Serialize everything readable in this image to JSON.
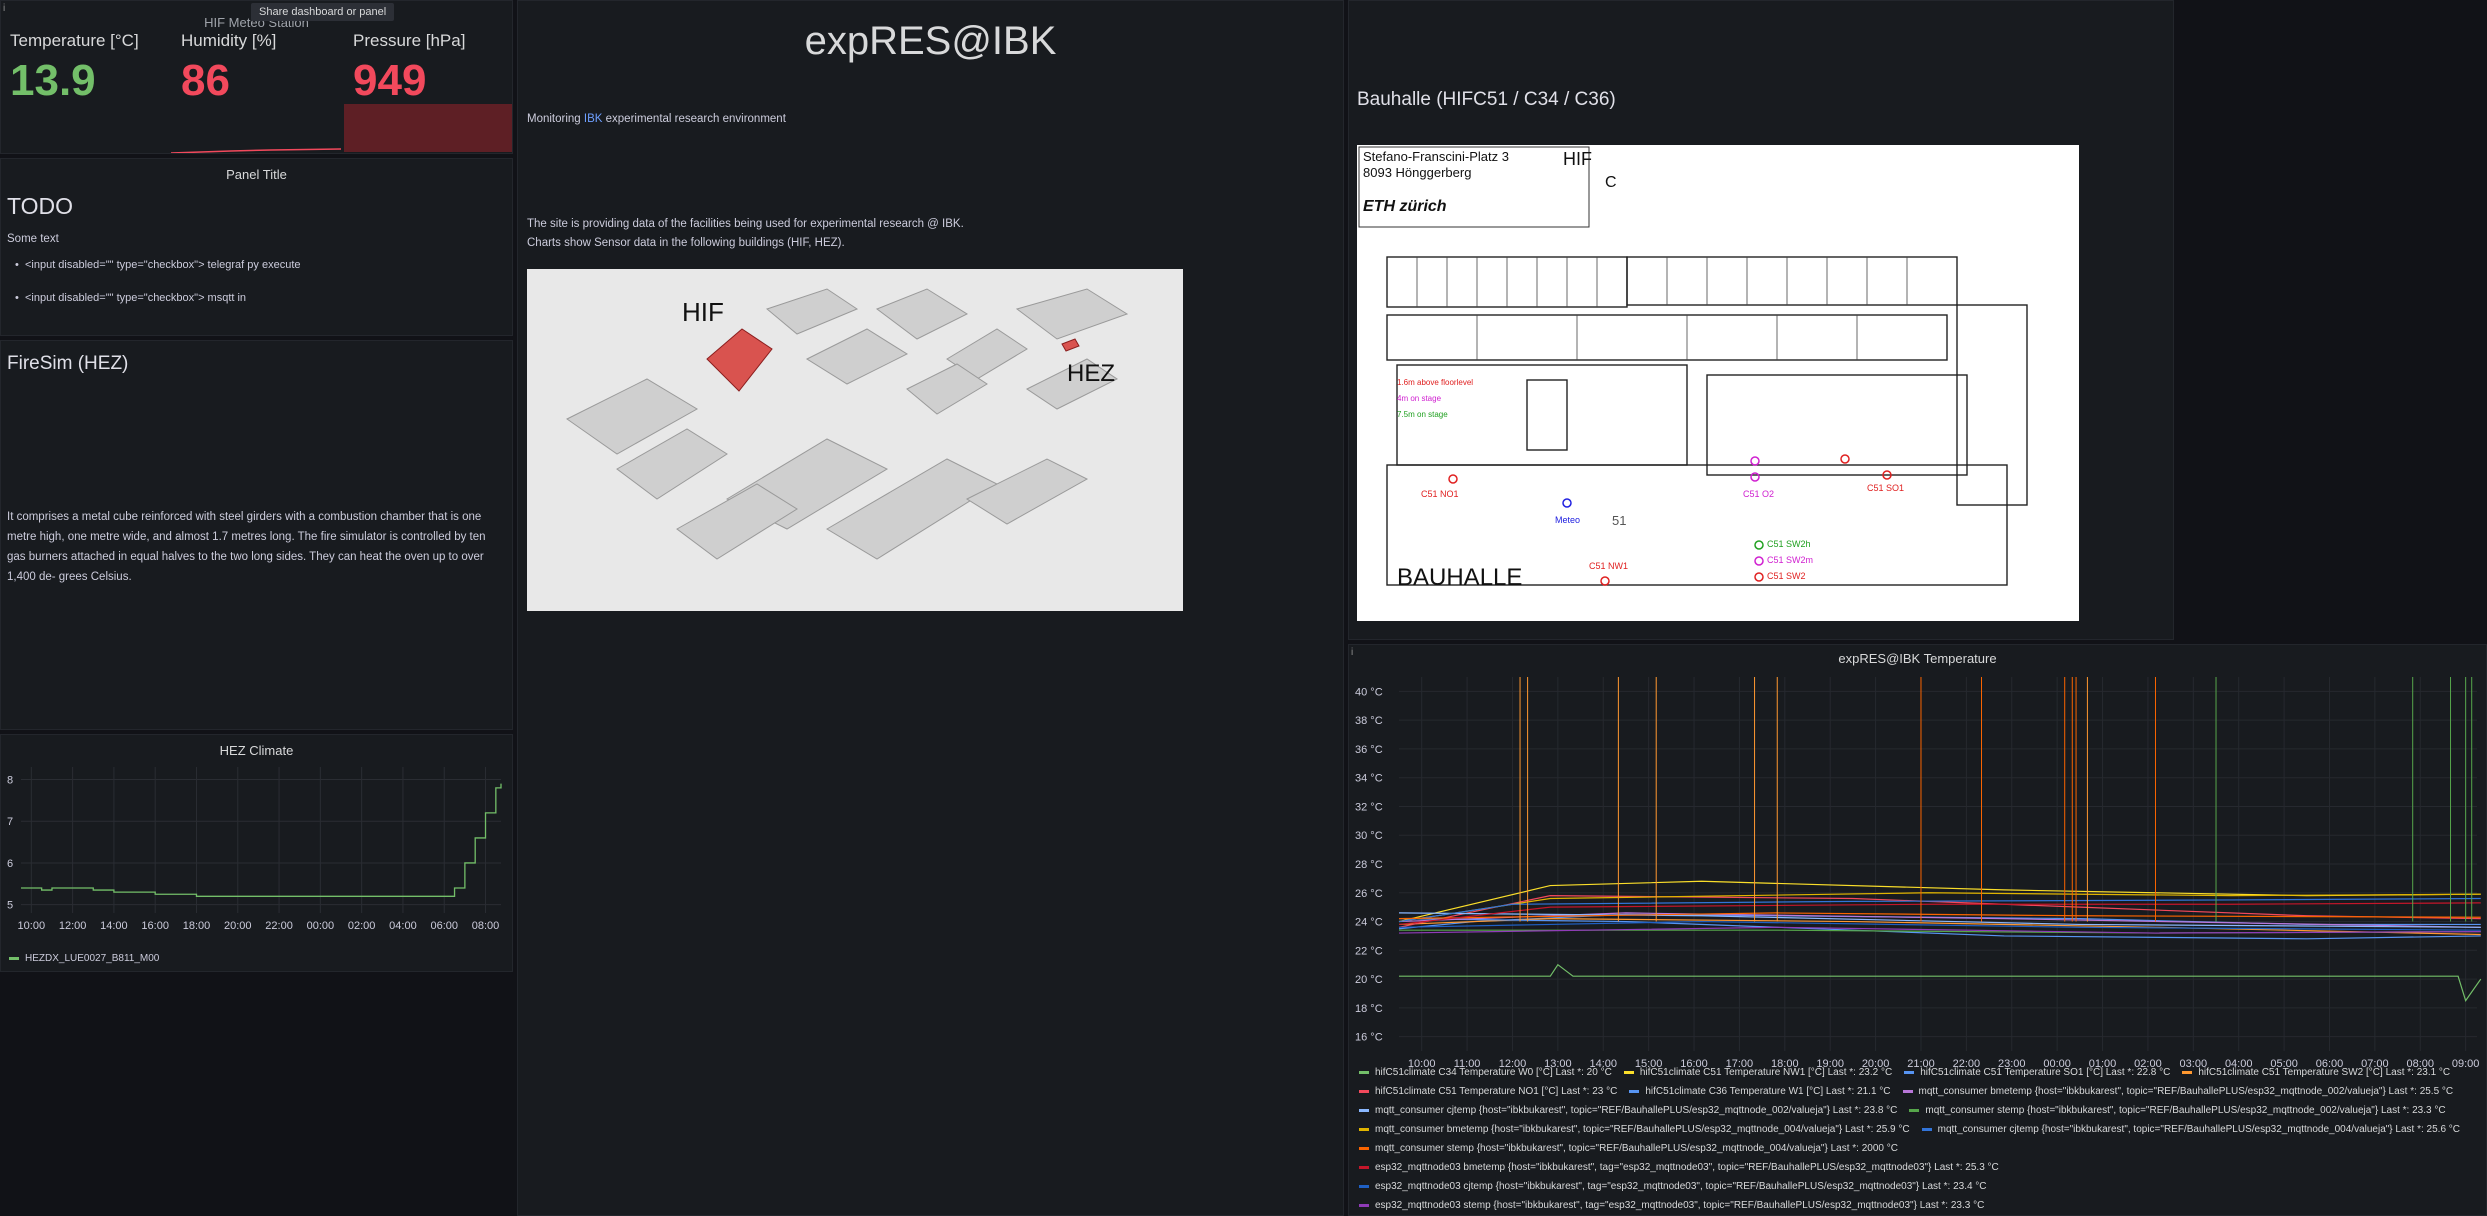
{
  "meteo": {
    "title": "HIF Meteo Station",
    "tooltip": "Share dashboard or panel",
    "corner": "i",
    "stats": [
      {
        "label": "Temperature [°C]",
        "value": "13.9",
        "color": "#73bf69"
      },
      {
        "label": "Humidity [%]",
        "value": "86",
        "color": "#f2495c"
      },
      {
        "label": "Pressure [hPa]",
        "value": "949",
        "color": "#f2495c"
      }
    ]
  },
  "todo": {
    "title": "Panel Title",
    "heading": "TODO",
    "text": "Some text",
    "items": [
      "<input disabled=\"\" type=\"checkbox\"> telegraf py execute",
      "<input disabled=\"\" type=\"checkbox\"> msqtt in"
    ]
  },
  "firesim": {
    "heading": "FireSim (HEZ)",
    "text": "It comprises a metal cube reinforced with steel girders with a combustion chamber that is one metre high, one metre wide, and almost 1.7 metres long. The fire simulator is controlled by ten gas burners attached in equal halves to the two long sides. They can heat the oven up to over 1,400 de- grees Celsius."
  },
  "hez": {
    "title": "HEZ Climate",
    "legend": "HEZDX_LUE0027_B811_M00",
    "series_color": "#73bf69",
    "chart_data": {
      "type": "line",
      "x": [
        "09:30",
        "10:00",
        "10:30",
        "11:00",
        "12:00",
        "13:00",
        "14:00",
        "15:00",
        "16:00",
        "18:00",
        "20:00",
        "22:00",
        "00:00",
        "02:00",
        "04:00",
        "06:00",
        "06:30",
        "07:00",
        "07:30",
        "08:00",
        "08:30",
        "08:45"
      ],
      "values": [
        5.4,
        5.4,
        5.35,
        5.4,
        5.4,
        5.35,
        5.3,
        5.3,
        5.25,
        5.2,
        5.2,
        5.2,
        5.2,
        5.2,
        5.2,
        5.2,
        5.4,
        6.0,
        6.6,
        7.2,
        7.8,
        7.9
      ],
      "xticks": [
        "10:00",
        "12:00",
        "14:00",
        "16:00",
        "18:00",
        "20:00",
        "22:00",
        "00:00",
        "02:00",
        "04:00",
        "06:00",
        "08:00"
      ],
      "yticks": [
        "5",
        "6",
        "7",
        "8"
      ],
      "ylim": [
        4.8,
        8.3
      ]
    }
  },
  "expres": {
    "title": "expRES@IBK",
    "line1_pre": "Monitoring ",
    "line1_link": "IBK",
    "line1_post": " experimental research environment",
    "line2": "The site is providing data of the facilities being used for experimental research @ IBK.",
    "line3": "Charts show Sensor data in the following buildings (HIF, HEZ).",
    "map_hif": "HIF",
    "map_hez": "HEZ"
  },
  "bauhalle": {
    "title": "Bauhalle (HIFC51 / C34 / C36)",
    "addr1": "Stefano-Franscini-Platz 3",
    "addr2": "8093 Hönggerberg",
    "logo": "ETH zürich",
    "bldg": "HIF",
    "bldg_letter": "C",
    "hall": "BAUHALLE",
    "room": "51",
    "legend": [
      "1.6m above floorlevel",
      "4m on stage",
      "7.5m on stage"
    ],
    "sensors": [
      "C51 NO1",
      "C51 NW1",
      "Meteo",
      "C51 SW2h",
      "C51 SW2m",
      "C51 SW2",
      "C51 SO1",
      "C51 O2"
    ]
  },
  "temp": {
    "title": "expRES@IBK Temperature",
    "corner": "i",
    "yticks": [
      "16 °C",
      "18 °C",
      "20 °C",
      "22 °C",
      "24 °C",
      "26 °C",
      "28 °C",
      "30 °C",
      "32 °C",
      "34 °C",
      "36 °C",
      "38 °C",
      "40 °C"
    ],
    "xticks": [
      "10:00",
      "11:00",
      "12:00",
      "13:00",
      "14:00",
      "15:00",
      "16:00",
      "17:00",
      "18:00",
      "19:00",
      "20:00",
      "21:00",
      "22:00",
      "23:00",
      "00:00",
      "01:00",
      "02:00",
      "03:00",
      "04:00",
      "05:00",
      "06:00",
      "07:00",
      "08:00",
      "09:00"
    ],
    "chart_data": {
      "type": "line",
      "ylim": [
        15,
        41
      ],
      "series": [
        {
          "name": "hifC51climate C34 Temperature W0 [°C]",
          "color": "#73bf69",
          "last": "20 °C"
        },
        {
          "name": "hifC51climate C51 Temperature NW1 [°C]",
          "color": "#fade2a",
          "last": "23.2 °C"
        },
        {
          "name": "hifC51climate C51 Temperature SO1 [°C]",
          "color": "#5794f2",
          "last": "22.8 °C"
        },
        {
          "name": "hifC51climate C51 Temperature SW2 [°C]",
          "color": "#ff9830",
          "last": "23.1 °C"
        },
        {
          "name": "hifC51climate C51 Temperature NO1 [°C]",
          "color": "#f2495c",
          "last": "23 °C"
        },
        {
          "name": "hifC51climate C36 Temperature W1 [°C]",
          "color": "#5794f2",
          "last": "21.1 °C"
        },
        {
          "name": "mqtt_consumer bmetemp {host=\"ibkbukarest\", topic=\"REF/BauhallePLUS/esp32_mqttnode_002/valueja\"}",
          "color": "#b877d9",
          "last": "25.5 °C"
        },
        {
          "name": "mqtt_consumer cjtemp {host=\"ibkbukarest\", topic=\"REF/BauhallePLUS/esp32_mqttnode_002/valueja\"}",
          "color": "#8ab8ff",
          "last": "23.8 °C"
        },
        {
          "name": "mqtt_consumer stemp {host=\"ibkbukarest\", topic=\"REF/BauhallePLUS/esp32_mqttnode_002/valueja\"}",
          "color": "#56a64b",
          "last": "23.3 °C"
        },
        {
          "name": "mqtt_consumer bmetemp {host=\"ibkbukarest\", topic=\"REF/BauhallePLUS/esp32_mqttnode_004/valueja\"}",
          "color": "#e0b400",
          "last": "25.9 °C"
        },
        {
          "name": "mqtt_consumer cjtemp {host=\"ibkbukarest\", topic=\"REF/BauhallePLUS/esp32_mqttnode_004/valueja\"}",
          "color": "#3274d9",
          "last": "25.6 °C"
        },
        {
          "name": "mqtt_consumer stemp {host=\"ibkbukarest\", topic=\"REF/BauhallePLUS/esp32_mqttnode_004/valueja\"}",
          "color": "#fa6400",
          "last": "2000 °C"
        },
        {
          "name": "esp32_mqttnode03 bmetemp {host=\"ibkbukarest\", tag=\"esp32_mqttnode03\", topic=\"REF/BauhallePLUS/esp32_mqttnode03\"}",
          "color": "#c4162a",
          "last": "25.3 °C"
        },
        {
          "name": "esp32_mqttnode03 cjtemp {host=\"ibkbukarest\", tag=\"esp32_mqttnode03\", topic=\"REF/BauhallePLUS/esp32_mqttnode03\"}",
          "color": "#1f60c4",
          "last": "23.4 °C"
        },
        {
          "name": "esp32_mqttnode03 stemp {host=\"ibkbukarest\", tag=\"esp32_mqttnode03\", topic=\"REF/BauhallePLUS/esp32_mqttnode03\"}",
          "color": "#8f3bb8",
          "last": "23.3 °C"
        }
      ]
    }
  }
}
